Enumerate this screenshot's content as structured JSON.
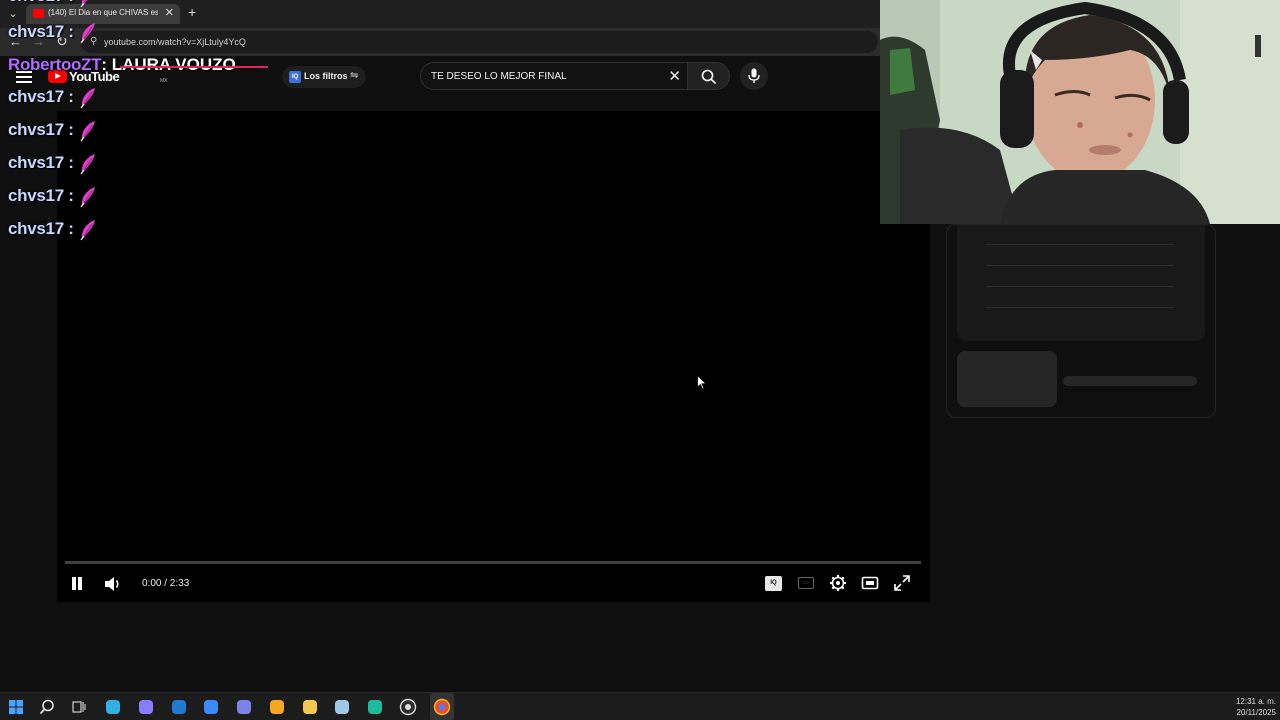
{
  "browser": {
    "tab_title": "(140) El Dia en que CHIVAS esta",
    "tab_close": "✕",
    "new_tab": "+",
    "url": "youtube.com/watch?v=XjLtuly4YcQ"
  },
  "youtube": {
    "logo_text": "YouTube",
    "country_code": "MX",
    "filter_chip_label": "Los filtros",
    "filter_chip_badge": "IQ",
    "search_value": "TE DESEO LO MEJOR FINAL",
    "search_clear": "✕"
  },
  "player": {
    "time_display": "0:00 / 2:33",
    "progress_fraction": 0.0,
    "iq_badge": "IQ"
  },
  "chat": {
    "messages": [
      {
        "user": "chvs17 :",
        "color": "#c8d7ff",
        "message": "",
        "emote": "pink-feather-emote"
      },
      {
        "user": "chvs17 :",
        "color": "#c8d7ff",
        "message": "",
        "emote": "pink-feather-emote"
      },
      {
        "user": "RobertooZT",
        "color": "#b06bff",
        "message": ": LAURA VOUZO",
        "emote": ""
      },
      {
        "user": "chvs17 :",
        "color": "#c8d7ff",
        "message": "",
        "emote": "pink-feather-emote"
      },
      {
        "user": "chvs17 :",
        "color": "#c8d7ff",
        "message": "",
        "emote": "pink-feather-emote"
      },
      {
        "user": "chvs17 :",
        "color": "#c8d7ff",
        "message": "",
        "emote": "pink-feather-emote"
      },
      {
        "user": "chvs17 :",
        "color": "#c8d7ff",
        "message": "",
        "emote": "pink-feather-emote"
      },
      {
        "user": "chvs17 :",
        "color": "#c8d7ff",
        "message": "",
        "emote": "pink-feather-emote"
      }
    ]
  },
  "taskbar": {
    "clock_time": "12:31 a. m.",
    "clock_date": "20/11/2025",
    "icons": [
      "windows-start-icon",
      "search-icon",
      "task-view-icon",
      "edge-icon",
      "copilot-icon",
      "outlook-icon",
      "store-icon",
      "teams-icon",
      "brave-icon",
      "file-explorer-icon",
      "notepad-icon",
      "app-icon",
      "obs-icon",
      "chrome-icon"
    ]
  },
  "colors": {
    "accent_red": "#ff0000",
    "page_bg": "#0f0f0f",
    "emote_pink": "#e040c8"
  }
}
